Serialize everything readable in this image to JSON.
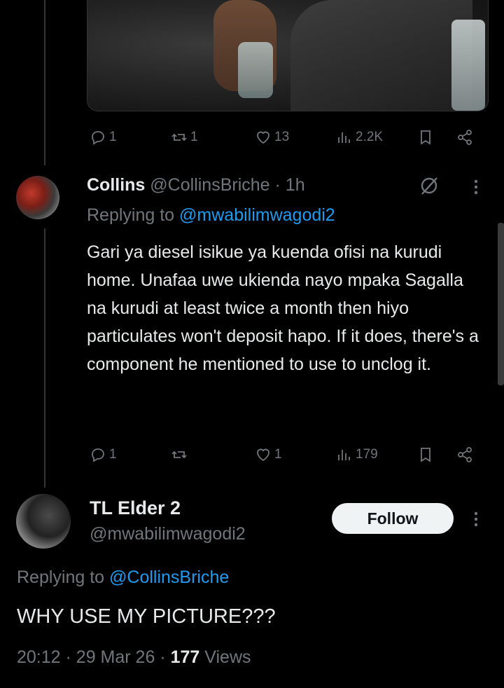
{
  "tweet1": {
    "stats": {
      "replies": "1",
      "reposts": "1",
      "likes": "13",
      "views": "2.2K"
    }
  },
  "reply": {
    "name": "Collins",
    "handle": "@CollinsBriche",
    "separator": "·",
    "time": "1h",
    "replying_prefix": "Replying to",
    "replying_to": "@mwabilimwagodi2",
    "text": "Gari ya diesel isikue ya kuenda ofisi na kurudi home. Unafaa uwe ukienda nayo mpaka Sagalla na kurudi at least twice a month then hiyo particulates won't deposit hapo. If it does, there's a component he mentioned to use to unclog it.",
    "stats": {
      "replies": "1",
      "reposts": "",
      "likes": "1",
      "views": "179"
    }
  },
  "main_tweet": {
    "name": "TL Elder 2",
    "handle": "@mwabilimwagodi2",
    "follow_label": "Follow",
    "replying_prefix": "Replying to",
    "replying_to": "@CollinsBriche",
    "text": "WHY USE MY PICTURE???",
    "time": "20:12",
    "sep1": "·",
    "date": "29 Mar 26",
    "sep2": "·",
    "views_count": "177",
    "views_label": "Views"
  },
  "colors": {
    "background": "#000000",
    "text": "#e7e9ea",
    "muted": "#71767b",
    "link": "#1d9bf0"
  },
  "icons": [
    "reply-icon",
    "repost-icon",
    "like-icon",
    "views-icon",
    "bookmark-icon",
    "share-icon",
    "grok-icon",
    "more-icon"
  ]
}
